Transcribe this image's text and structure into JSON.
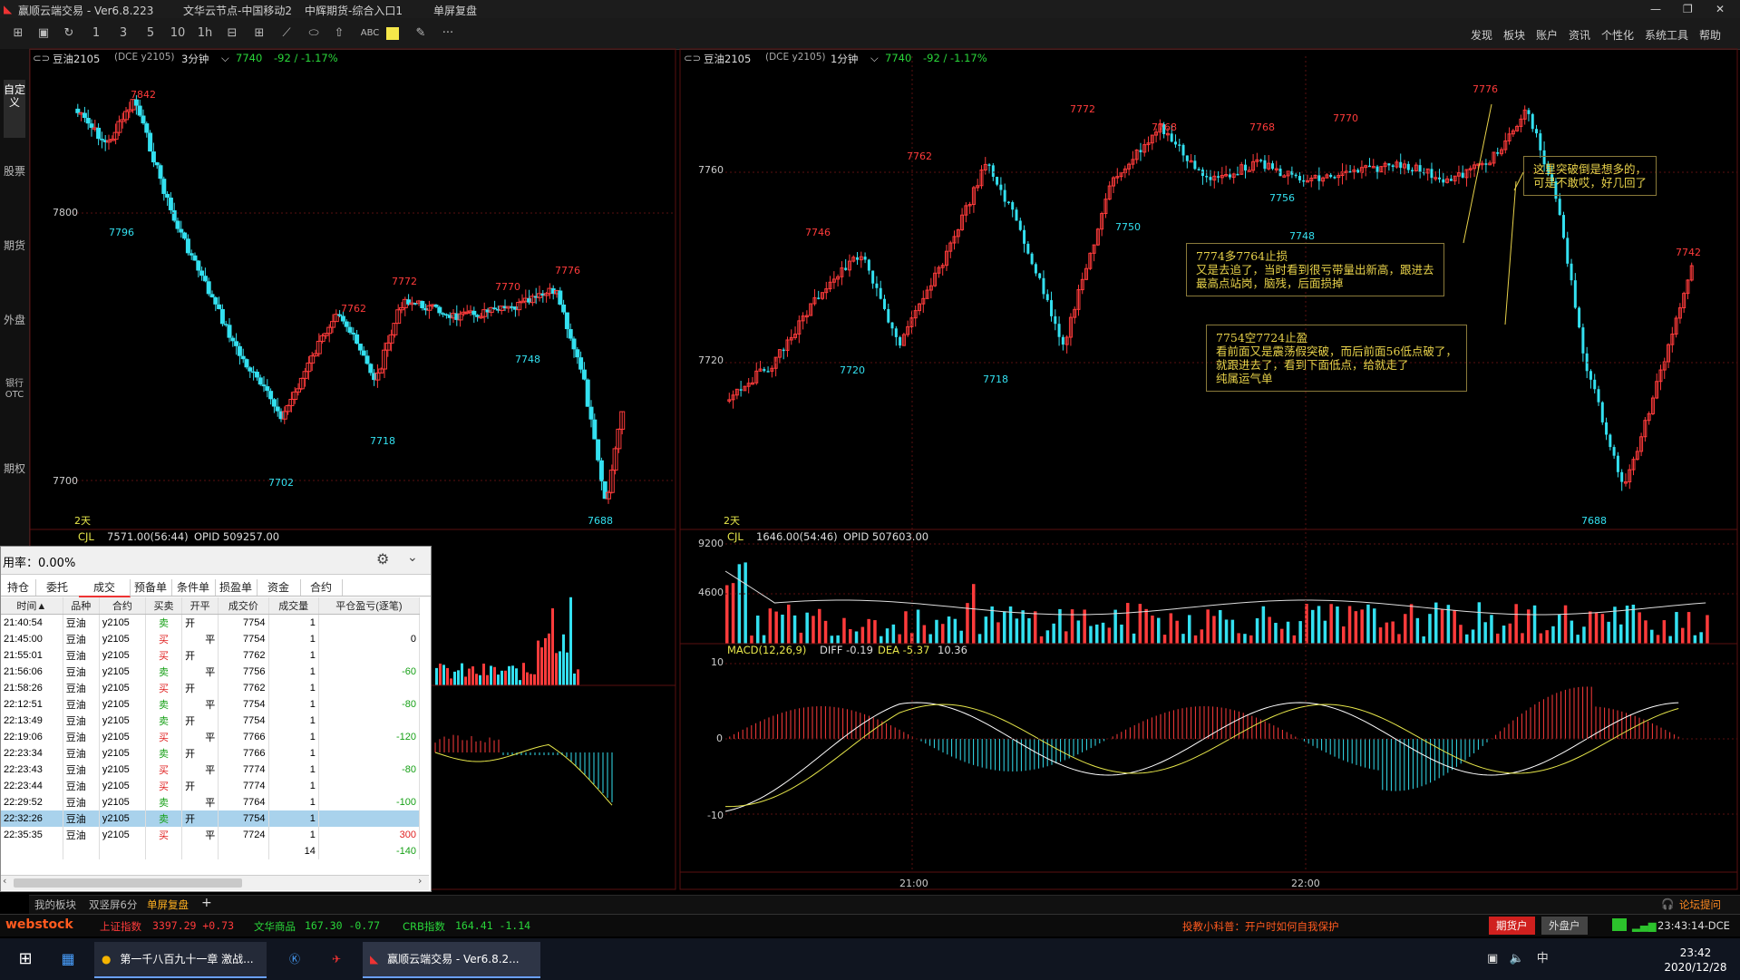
{
  "titlebar": {
    "app_title": "赢顺云端交易 - Ver6.8.223",
    "node": "文华云节点-中国移动2",
    "broker": "中辉期货-综合入口1",
    "mode": "单屏复盘"
  },
  "menu": {
    "items": [
      "发现",
      "板块",
      "账户",
      "资讯",
      "个性化",
      "系统工具",
      "帮助"
    ]
  },
  "toolbar": {
    "icons": [
      "layout-icon",
      "save-icon",
      "refresh-icon",
      "period-1-icon",
      "period-3-icon",
      "period-5-icon",
      "period-10-icon",
      "period-1h-icon",
      "split-icon",
      "grid-icon",
      "line-tool-icon",
      "ellipse-tool-icon",
      "arrow-tool-icon",
      "text-tool-icon",
      "color-tool-icon",
      "pen-tool-icon",
      "more-icon"
    ],
    "labels": [
      "1",
      "3",
      "5",
      "10",
      "1h",
      "ABC",
      "···"
    ]
  },
  "sidebar": {
    "tabs": [
      "自定义",
      "股票",
      "期货",
      "外盘",
      "银行OTC",
      "期权"
    ]
  },
  "left_chart": {
    "symbol": "豆油2105",
    "exchange": "(DCE y2105)",
    "period": "3分钟",
    "price": "7740",
    "change": "-92 / -1.17%",
    "days_label": "2天",
    "vol_label": "CJL",
    "vol_value": "7571.00(56:44)",
    "opid": "OPID 509257.00",
    "y_labels": [
      "7800",
      "7700"
    ],
    "highlights": [
      {
        "label": "7842",
        "kind": "high"
      },
      {
        "label": "7796",
        "kind": "low"
      },
      {
        "label": "7762",
        "kind": "high"
      },
      {
        "label": "7772",
        "kind": "high"
      },
      {
        "label": "7770",
        "kind": "high"
      },
      {
        "label": "7776",
        "kind": "high"
      },
      {
        "label": "7748",
        "kind": "low"
      },
      {
        "label": "7718",
        "kind": "low"
      },
      {
        "label": "7702",
        "kind": "low"
      },
      {
        "label": "7688",
        "kind": "low"
      }
    ]
  },
  "right_chart": {
    "symbol": "豆油2105",
    "exchange": "(DCE y2105)",
    "period": "1分钟",
    "price": "7740",
    "change": "-92 / -1.17%",
    "days_label": "2天",
    "vol_label": "CJL",
    "vol_value": "1646.00(54:46)",
    "opid": "OPID 507603.00",
    "y_labels": [
      "7760",
      "7720"
    ],
    "vol_y_labels": [
      "9200",
      "4600"
    ],
    "macd_label": "MACD(12,26,9)",
    "macd_diff": "DIFF -0.19",
    "macd_dea": "DEA -5.37",
    "macd_val": "10.36",
    "macd_y_labels": [
      "10",
      "0",
      "-10"
    ],
    "x_labels": [
      "21:00",
      "22:00"
    ],
    "highlights": [
      {
        "label": "7772",
        "kind": "high"
      },
      {
        "label": "7762",
        "kind": "high"
      },
      {
        "label": "7746",
        "kind": "high"
      },
      {
        "label": "7720",
        "kind": "low"
      },
      {
        "label": "7718",
        "kind": "low"
      },
      {
        "label": "7768",
        "kind": "high"
      },
      {
        "label": "7750",
        "kind": "low"
      },
      {
        "label": "7768",
        "kind": "high"
      },
      {
        "label": "7756",
        "kind": "low"
      },
      {
        "label": "7770",
        "kind": "high"
      },
      {
        "label": "7748",
        "kind": "low"
      },
      {
        "label": "7776",
        "kind": "high"
      },
      {
        "label": "7742",
        "kind": "high"
      },
      {
        "label": "7688",
        "kind": "low"
      }
    ],
    "annotations": [
      "这里突破倒是想多的，\n可是不敢哎，好几回了",
      "7774多7764止损\n又是去追了，当时看到很亏带量出新高，跟进去\n最高点站岗，脑残，后面损掉",
      "7754空7724止盈\n看前面又是震荡假突破，而后前面56低点破了，\n就跟进去了，看到下面低点，给就走了\n纯属运气单"
    ]
  },
  "trade_window": {
    "title": "用率：0.00%",
    "tabs": [
      "持仓",
      "委托",
      "成交",
      "预备单",
      "条件单",
      "损盈单",
      "资金",
      "合约"
    ],
    "active_tab": "成交",
    "columns": [
      "时间▲",
      "品种",
      "合约",
      "买卖",
      "开平",
      "成交价",
      "成交量",
      "平仓盈亏(逐笔)"
    ],
    "rows": [
      [
        "21:40:54",
        "豆油",
        "y2105",
        "卖",
        "开",
        "7754",
        "1",
        ""
      ],
      [
        "21:45:00",
        "豆油",
        "y2105",
        "买",
        "平",
        "7754",
        "1",
        "0"
      ],
      [
        "21:55:01",
        "豆油",
        "y2105",
        "买",
        "开",
        "7762",
        "1",
        ""
      ],
      [
        "21:56:06",
        "豆油",
        "y2105",
        "卖",
        "平",
        "7756",
        "1",
        "-60"
      ],
      [
        "21:58:26",
        "豆油",
        "y2105",
        "买",
        "开",
        "7762",
        "1",
        ""
      ],
      [
        "22:12:51",
        "豆油",
        "y2105",
        "卖",
        "平",
        "7754",
        "1",
        "-80"
      ],
      [
        "22:13:49",
        "豆油",
        "y2105",
        "卖",
        "开",
        "7754",
        "1",
        ""
      ],
      [
        "22:19:06",
        "豆油",
        "y2105",
        "买",
        "平",
        "7766",
        "1",
        "-120"
      ],
      [
        "22:23:34",
        "豆油",
        "y2105",
        "卖",
        "开",
        "7766",
        "1",
        ""
      ],
      [
        "22:23:43",
        "豆油",
        "y2105",
        "买",
        "平",
        "7774",
        "1",
        "-80"
      ],
      [
        "22:23:44",
        "豆油",
        "y2105",
        "买",
        "开",
        "7774",
        "1",
        ""
      ],
      [
        "22:29:52",
        "豆油",
        "y2105",
        "卖",
        "平",
        "7764",
        "1",
        "-100"
      ],
      [
        "22:32:26",
        "豆油",
        "y2105",
        "卖",
        "开",
        "7754",
        "1",
        ""
      ],
      [
        "22:35:35",
        "豆油",
        "y2105",
        "买",
        "平",
        "7724",
        "1",
        "300"
      ]
    ],
    "selected_row": 12,
    "total_qty": "14",
    "total_pnl": "-140"
  },
  "bottom_tabs": [
    "我的板块",
    "双竖屏6分",
    "单屏复盘"
  ],
  "forum": "论坛提问",
  "statusbar": {
    "brand": "webstock",
    "idx1_name": "上证指数",
    "idx1_val": "3397.29 +0.73",
    "idx2_name": "文华商品",
    "idx2_val": "167.30 -0.77",
    "idx3_name": "CRB指数",
    "idx3_val": "164.41 -1.14",
    "ticker": "投教小科普：开户时如何自我保护",
    "btn_fut": "期货户",
    "btn_ext": "外盘户",
    "clock": "23:43:14-DCE"
  },
  "taskbar": {
    "items": [
      "第一千八百九十一章 激战...",
      "赢顺云端交易 - Ver6.8.2..."
    ],
    "time": "23:42",
    "date": "2020/12/28",
    "ime": "中"
  },
  "colors": {
    "up": "#ff3b3b",
    "down": "#33e0f0",
    "annotation": "#e8d24a",
    "grid": "#5a1010"
  }
}
